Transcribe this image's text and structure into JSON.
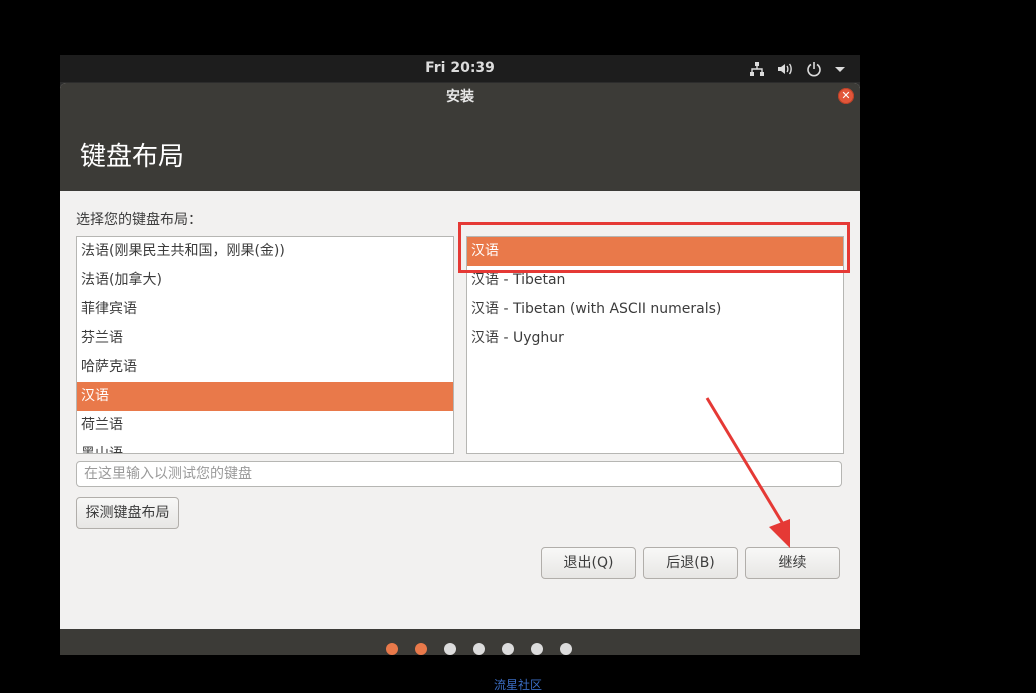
{
  "topbar": {
    "clock": "Fri 20:39",
    "icons": [
      "network-icon",
      "volume-icon",
      "power-icon",
      "chevron-down-icon"
    ]
  },
  "window": {
    "title": "安装",
    "close_icon": "close-icon"
  },
  "header": {
    "title": "键盘布局"
  },
  "prompt": "选择您的键盘布局：",
  "layouts": [
    {
      "label": "法语(刚果民主共和国，刚果(金))",
      "selected": false
    },
    {
      "label": "法语(加拿大)",
      "selected": false
    },
    {
      "label": "菲律宾语",
      "selected": false
    },
    {
      "label": "芬兰语",
      "selected": false
    },
    {
      "label": "哈萨克语",
      "selected": false
    },
    {
      "label": "汉语",
      "selected": true
    },
    {
      "label": "荷兰语",
      "selected": false
    },
    {
      "label": "黑山语",
      "selected": false
    }
  ],
  "variants": [
    {
      "label": "汉语",
      "selected": true
    },
    {
      "label": "汉语 - Tibetan",
      "selected": false
    },
    {
      "label": "汉语 - Tibetan (with ASCII numerals)",
      "selected": false
    },
    {
      "label": "汉语 - Uyghur",
      "selected": false
    }
  ],
  "test_input": {
    "placeholder": "在这里输入以测试您的键盘",
    "value": ""
  },
  "buttons": {
    "detect": "探测键盘布局",
    "quit": "退出(Q)",
    "back": "后退(B)",
    "continue": "继续"
  },
  "progress": {
    "total_steps": 7,
    "completed_steps": 2
  },
  "colors": {
    "accent": "#e9794a",
    "annotation": "#e53935",
    "header": "#3c3b37"
  },
  "watermark": "流星社区"
}
